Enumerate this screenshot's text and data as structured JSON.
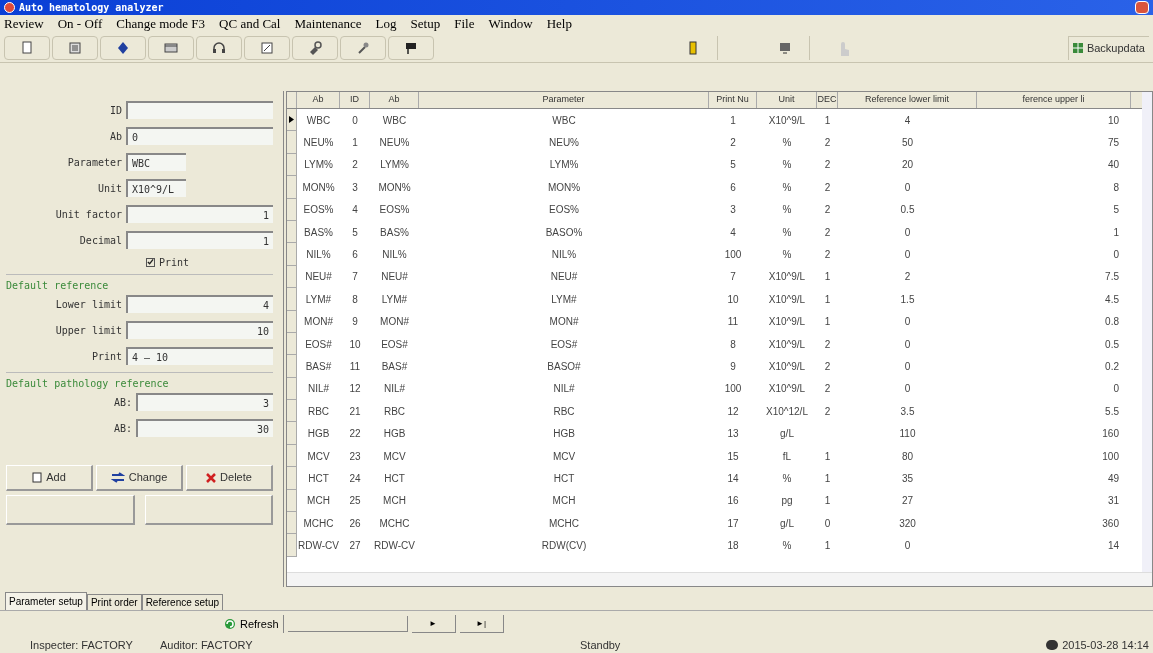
{
  "window": {
    "title": "Auto hematology analyzer"
  },
  "menu": [
    "Review",
    "On - Off",
    "Change mode F3",
    "QC and Cal",
    "Maintenance",
    "Log",
    "Setup",
    "File",
    "Window",
    "Help"
  ],
  "toolbar": {
    "backup_button": "Backupdata"
  },
  "form": {
    "fields": [
      {
        "label": "ID"
      },
      {
        "label": "Ab",
        "value": "0"
      },
      {
        "label": "Parameter",
        "value": "WBC"
      },
      {
        "label": "Unit",
        "value": "X10^9/L"
      },
      {
        "label": "Unit factor",
        "value": "1"
      },
      {
        "label": "Decimal",
        "value": "1"
      }
    ],
    "print": {
      "label": "Print",
      "checked": true
    },
    "default_reference": {
      "title": "Default reference",
      "fields": [
        {
          "label": "Lower limit",
          "value": "4"
        },
        {
          "label": "Upper limit",
          "value": "10"
        },
        {
          "label": "Print",
          "value": "4 — 10"
        }
      ]
    },
    "pathology_reference": {
      "title": "Default pathology reference",
      "fields": [
        {
          "label": "AB:",
          "value": "3"
        },
        {
          "label": "AB:",
          "value": "30"
        }
      ]
    },
    "buttons": [
      {
        "kind": "add",
        "label": "Add"
      },
      {
        "kind": "change",
        "label": "Change"
      },
      {
        "kind": "delete",
        "label": "Delete"
      },
      {
        "kind": "blank"
      },
      {
        "kind": "blank"
      }
    ]
  },
  "table": {
    "columns": [
      "Ab",
      "ID",
      "Ab",
      "Parameter",
      "Print Nu",
      "Unit",
      "DEC",
      "Reference lower limit",
      "ference upper li"
    ],
    "rows": [
      {
        "selected": true,
        "cells": [
          "WBC",
          "0",
          "WBC",
          "WBC",
          "1",
          "X10^9/L",
          "1",
          "4",
          "10"
        ]
      },
      {
        "selected": false,
        "cells": [
          "NEU%",
          "1",
          "NEU%",
          "NEU%",
          "2",
          "%",
          "2",
          "50",
          "75"
        ]
      },
      {
        "selected": false,
        "cells": [
          "LYM%",
          "2",
          "LYM%",
          "LYM%",
          "5",
          "%",
          "2",
          "20",
          "40"
        ]
      },
      {
        "selected": false,
        "cells": [
          "MON%",
          "3",
          "MON%",
          "MON%",
          "6",
          "%",
          "2",
          "0",
          "8"
        ]
      },
      {
        "selected": false,
        "cells": [
          "EOS%",
          "4",
          "EOS%",
          "EOS%",
          "3",
          "%",
          "2",
          "0.5",
          "5"
        ]
      },
      {
        "selected": false,
        "cells": [
          "BAS%",
          "5",
          "BAS%",
          "BASO%",
          "4",
          "%",
          "2",
          "0",
          "1"
        ]
      },
      {
        "selected": false,
        "cells": [
          "NIL%",
          "6",
          "NIL%",
          "NIL%",
          "100",
          "%",
          "2",
          "0",
          "0"
        ]
      },
      {
        "selected": false,
        "cells": [
          "NEU#",
          "7",
          "NEU#",
          "NEU#",
          "7",
          "X10^9/L",
          "1",
          "2",
          "7.5"
        ]
      },
      {
        "selected": false,
        "cells": [
          "LYM#",
          "8",
          "LYM#",
          "LYM#",
          "10",
          "X10^9/L",
          "1",
          "1.5",
          "4.5"
        ]
      },
      {
        "selected": false,
        "cells": [
          "MON#",
          "9",
          "MON#",
          "MON#",
          "11",
          "X10^9/L",
          "1",
          "0",
          "0.8"
        ]
      },
      {
        "selected": false,
        "cells": [
          "EOS#",
          "10",
          "EOS#",
          "EOS#",
          "8",
          "X10^9/L",
          "2",
          "0",
          "0.5"
        ]
      },
      {
        "selected": false,
        "cells": [
          "BAS#",
          "11",
          "BAS#",
          "BASO#",
          "9",
          "X10^9/L",
          "2",
          "0",
          "0.2"
        ]
      },
      {
        "selected": false,
        "cells": [
          "NIL#",
          "12",
          "NIL#",
          "NIL#",
          "100",
          "X10^9/L",
          "2",
          "0",
          "0"
        ]
      },
      {
        "selected": false,
        "cells": [
          "RBC",
          "21",
          "RBC",
          "RBC",
          "12",
          "X10^12/L",
          "2",
          "3.5",
          "5.5"
        ]
      },
      {
        "selected": false,
        "cells": [
          "HGB",
          "22",
          "HGB",
          "HGB",
          "13",
          "g/L",
          "",
          "110",
          "160"
        ]
      },
      {
        "selected": false,
        "cells": [
          "MCV",
          "23",
          "MCV",
          "MCV",
          "15",
          "fL",
          "1",
          "80",
          "100"
        ]
      },
      {
        "selected": false,
        "cells": [
          "HCT",
          "24",
          "HCT",
          "HCT",
          "14",
          "%",
          "1",
          "35",
          "49"
        ]
      },
      {
        "selected": false,
        "cells": [
          "MCH",
          "25",
          "MCH",
          "MCH",
          "16",
          "pg",
          "1",
          "27",
          "31"
        ]
      },
      {
        "selected": false,
        "cells": [
          "MCHC",
          "26",
          "MCHC",
          "MCHC",
          "17",
          "g/L",
          "0",
          "320",
          "360"
        ]
      },
      {
        "selected": false,
        "cells": [
          "RDW-CV",
          "27",
          "RDW-CV",
          "RDW(CV)",
          "18",
          "%",
          "1",
          "0",
          "14"
        ]
      }
    ]
  },
  "tabs": [
    {
      "label": "Parameter setup",
      "selected": true
    },
    {
      "label": "Print order",
      "selected": false
    },
    {
      "label": "Reference setup",
      "selected": false
    }
  ],
  "navigator": {
    "refresh": "Refresh",
    "next": "►",
    "last": "►|"
  },
  "status_bar": {
    "inspector": "Inspecter: FACTORY",
    "auditor": "Auditor: FACTORY",
    "state": "Standby",
    "datetime": "2015-03-28 14:14"
  }
}
